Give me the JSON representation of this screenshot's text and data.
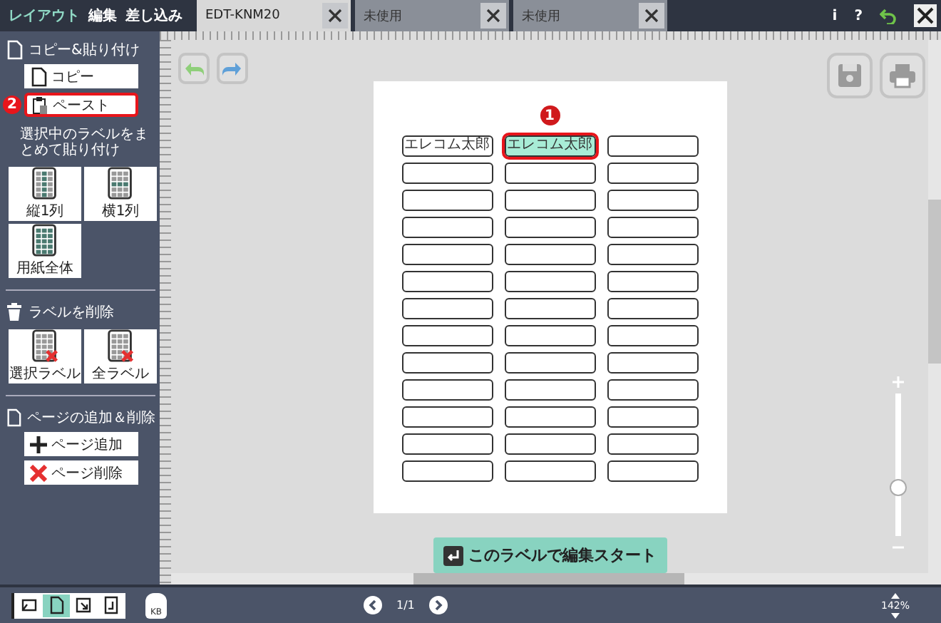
{
  "sidebar_tabs": [
    {
      "label": "レイアウト",
      "selected": true
    },
    {
      "label": "編集",
      "selected": false
    },
    {
      "label": "差し込み",
      "selected": false
    }
  ],
  "document_tabs": [
    {
      "label": "EDT-KNM20",
      "selected": true
    },
    {
      "label": "未使用",
      "selected": false
    },
    {
      "label": "未使用",
      "selected": false
    }
  ],
  "title_icons": [
    "i",
    "?"
  ],
  "sidebar": [
    {
      "kind": "copy",
      "title": "コピー&貼り付け",
      "buttons": [
        {
          "kind": "copy",
          "label": "コピー",
          "highlighted": false
        },
        {
          "kind": "paste",
          "label": "ペースト",
          "highlighted": true,
          "marker": "2"
        }
      ],
      "note": "選択中のラベルをまとめて貼り付け",
      "tiles": [
        {
          "kind": "column",
          "label": "縦1列"
        },
        {
          "kind": "row",
          "label": "横1列"
        },
        {
          "kind": "sheet",
          "label": "用紙全体"
        }
      ]
    },
    {
      "kind": "delete",
      "title": "ラベルを削除",
      "tiles": [
        {
          "kind": "selected",
          "label": "選択ラベル"
        },
        {
          "kind": "all",
          "label": "全ラベル"
        }
      ]
    },
    {
      "kind": "page",
      "title": "ページの追加＆削除",
      "buttons": [
        {
          "kind": "add",
          "label": "ページ追加",
          "highlighted": false
        },
        {
          "kind": "remove",
          "label": "ページ削除",
          "highlighted": false
        }
      ]
    }
  ],
  "labels": [
    {
      "text": "エレコム太郎",
      "selected": false
    },
    {
      "text": "エレコム太郎",
      "selected": true,
      "marker": "1"
    },
    {
      "selected": false
    },
    {
      "selected": false
    },
    {
      "selected": false
    },
    {
      "selected": false
    },
    {
      "selected": false
    },
    {
      "selected": false
    },
    {
      "selected": false
    },
    {
      "selected": false
    },
    {
      "selected": false
    },
    {
      "selected": false
    },
    {
      "selected": false
    },
    {
      "selected": false
    },
    {
      "selected": false
    },
    {
      "selected": false
    },
    {
      "selected": false
    },
    {
      "selected": false
    },
    {
      "selected": false
    },
    {
      "selected": false
    },
    {
      "selected": false
    },
    {
      "selected": false
    },
    {
      "selected": false
    },
    {
      "selected": false
    },
    {
      "selected": false
    },
    {
      "selected": false
    },
    {
      "selected": false
    },
    {
      "selected": false
    },
    {
      "selected": false
    },
    {
      "selected": false
    },
    {
      "selected": false
    },
    {
      "selected": false
    },
    {
      "selected": false
    },
    {
      "selected": false
    },
    {
      "selected": false
    },
    {
      "selected": false
    },
    {
      "selected": false
    },
    {
      "selected": false
    },
    {
      "selected": false
    }
  ],
  "edit_button": "このラベルで編集スタート",
  "zoom_slider": {
    "level": 0.33
  },
  "status_bar": {
    "view_modes": [
      {
        "kind": "landscape",
        "selected": false
      },
      {
        "kind": "portrait",
        "selected": true
      },
      {
        "kind": "turn",
        "selected": false
      },
      {
        "kind": "flip",
        "selected": false
      }
    ],
    "weight_unit": "KB",
    "page": "1/1",
    "zoom": "142%"
  }
}
